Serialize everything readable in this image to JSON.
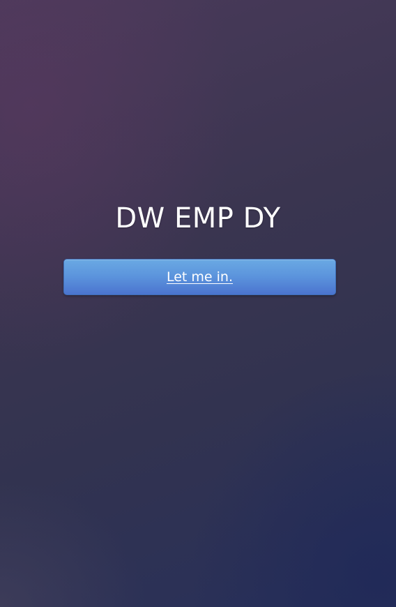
{
  "app": {
    "title": "DW EMP DY"
  },
  "actions": {
    "login_label": "Let me in."
  },
  "colors": {
    "background_top_left": "#4a3a5a",
    "background_bottom_right": "#28305a",
    "button_top": "#6aa9e3",
    "button_bottom": "#4b74cf",
    "text": "#ffffff"
  }
}
